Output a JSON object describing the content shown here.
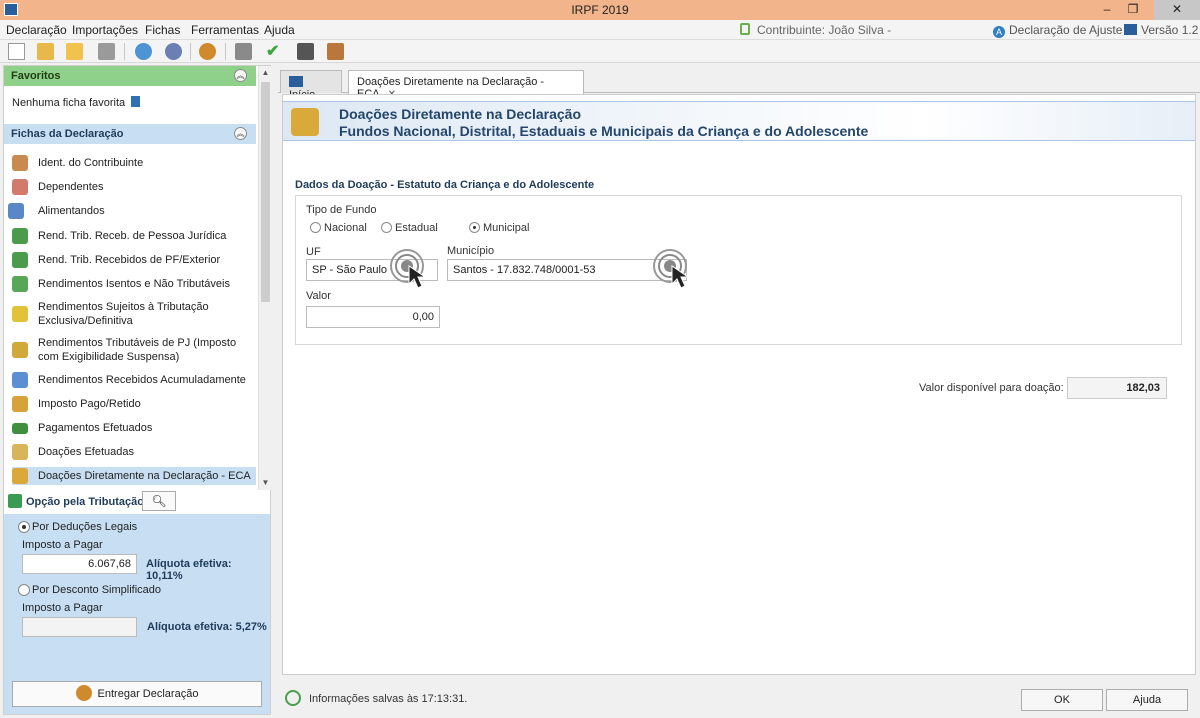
{
  "window": {
    "title": "IRPF 2019",
    "minimize": "–",
    "restore": "❐",
    "close": "✕"
  },
  "menu": {
    "items": [
      "Declaração",
      "Importações",
      "Fichas",
      "Ferramentas",
      "Ajuda"
    ],
    "contribuinte": "Contribuinte: João Silva -",
    "declaracao_ajuste": "Declaração de Ajuste",
    "versao": "Versão 1.2"
  },
  "sidebar": {
    "favoritos_title": "Favoritos",
    "favoritos_empty": "Nenhuma ficha favorita",
    "fichas_title": "Fichas da Declaração",
    "items": [
      {
        "label": "Ident. do Contribuinte",
        "icon": "person-icon",
        "color": "#c98a52"
      },
      {
        "label": "Dependentes",
        "icon": "dependents-icon",
        "color": "#d27a6b"
      },
      {
        "label": "Alimentandos",
        "icon": "alimentandos-icon",
        "color": "#5a88c7"
      },
      {
        "label": "Rend. Trib. Receb. de Pessoa Jurídica",
        "icon": "money-arrow-icon",
        "color": "#4c9b4c"
      },
      {
        "label": "Rend. Trib. Recebidos de PF/Exterior",
        "icon": "money-arrow-icon",
        "color": "#4c9b4c"
      },
      {
        "label": "Rendimentos Isentos e Não Tributáveis",
        "icon": "check-doc-icon",
        "color": "#58a658"
      },
      {
        "label": "Rendimentos Sujeitos à Tributação Exclusiva/Definitiva",
        "icon": "warning-doc-icon",
        "color": "#e3c23a"
      },
      {
        "label": "Rendimentos Tributáveis de PJ (Imposto com Exigibilidade Suspensa)",
        "icon": "warning-money-icon",
        "color": "#d1a83a"
      },
      {
        "label": "Rendimentos Recebidos Acumuladamente",
        "icon": "refresh-doc-icon",
        "color": "#5b8fd1"
      },
      {
        "label": "Imposto Pago/Retido",
        "icon": "coin-person-icon",
        "color": "#d6a23a"
      },
      {
        "label": "Pagamentos Efetuados",
        "icon": "card-icon",
        "color": "#3f8f3f"
      },
      {
        "label": "Doações Efetuadas",
        "icon": "donation-doc-icon",
        "color": "#d8b45a"
      },
      {
        "label": "Doações Diretamente na Declaração - ECA",
        "icon": "eca-icon",
        "color": "#d9a93a"
      }
    ],
    "opcao_title": "Opção pela Tributação:",
    "deducoes_label": "Por Deduções Legais",
    "imposto_label_1": "Imposto a Pagar",
    "imposto_value_1": "6.067,68",
    "aliquota_1": "Alíquota efetiva: 10,11%",
    "simplificado_label": "Por Desconto Simplificado",
    "imposto_label_2": "Imposto a Pagar",
    "imposto_value_2": "",
    "aliquota_2": "Alíquota efetiva: 5,27%",
    "entregar": "Entregar Declaração"
  },
  "tabs": [
    {
      "label": "Início"
    },
    {
      "label": "Doações Diretamente na Declaração - ECA"
    }
  ],
  "banner": {
    "line1": "Doações Diretamente na Declaração",
    "line2": "Fundos Nacional, Distrital, Estaduais e Municipais da Criança e do Adolescente"
  },
  "form": {
    "section_title": "Dados da Doação - Estatuto da Criança e do Adolescente",
    "tipo_fundo_label": "Tipo de Fundo",
    "options": [
      "Nacional",
      "Estadual",
      "Municipal"
    ],
    "selected_option": "Municipal",
    "uf_label": "UF",
    "uf_value": "SP - São Paulo",
    "municipio_label": "Município",
    "municipio_value": "Santos - 17.832.748/0001-53",
    "valor_label": "Valor",
    "valor_value": "0,00",
    "valor_disponivel_label": "Valor disponível para doação:",
    "valor_disponivel_value": "182,03"
  },
  "status": {
    "message": "Informações salvas às 17:13:31.",
    "ok": "OK",
    "ajuda": "Ajuda"
  }
}
